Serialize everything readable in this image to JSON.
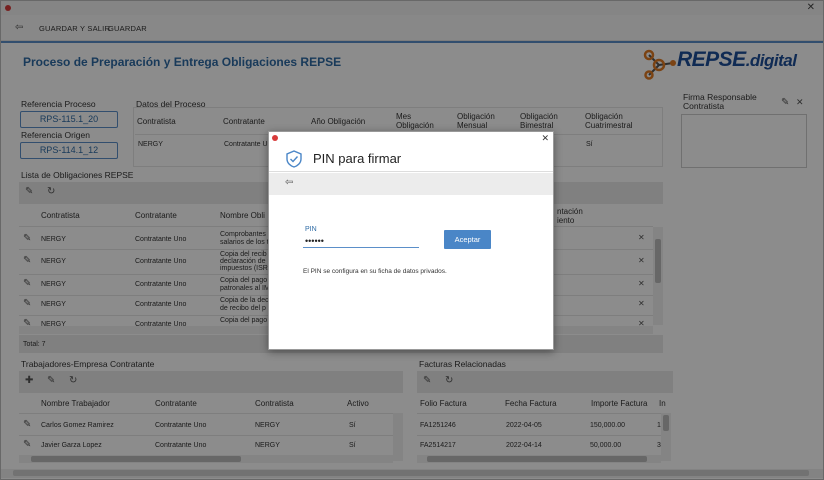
{
  "toolbar": {
    "save_exit_label": "GUARDAR Y SALIR",
    "save_label": "GUARDAR"
  },
  "header": {
    "title": "Proceso de Preparación y Entrega Obligaciones REPSE",
    "logo_text_main": "REPSE",
    "logo_text_suffix": ".digital"
  },
  "references": {
    "process_label": "Referencia Proceso",
    "process_value": "RPS-115.1_20",
    "origin_label": "Referencia Origen",
    "origin_value": "RPS-114.1_12"
  },
  "process_data": {
    "title": "Datos del Proceso",
    "headers": [
      "Contratista",
      "Contratante",
      "Año Obligación",
      "Mes Obligación",
      "Obligación Mensual",
      "Obligación Bimestral",
      "Obligación Cuatrimestral"
    ],
    "row": {
      "contratista": "NERGY",
      "contratante": "Contratante Un",
      "cuatrimestral": "Sí"
    }
  },
  "obligations": {
    "title": "Lista de Obligaciones REPSE",
    "headers": [
      "Contratista",
      "Contratante",
      "Nombre Obli",
      "ntación",
      "iento"
    ],
    "rows": [
      {
        "contratista": "NERGY",
        "contratante": "Contratante Uno",
        "nombre1": "Comprobantes",
        "nombre2": "salarios de los t"
      },
      {
        "contratista": "NERGY",
        "contratante": "Contratante Uno",
        "nombre1": "Copia del recib",
        "nombre2": "declaración de",
        "nombre3": "impuestos (ISR"
      },
      {
        "contratista": "NERGY",
        "contratante": "Contratante Uno",
        "nombre1": "Copia del pago",
        "nombre2": "patronales al IM"
      },
      {
        "contratista": "NERGY",
        "contratante": "Contratante Uno",
        "nombre1": "Copia de la dec",
        "nombre2": "de recibo del p"
      },
      {
        "contratista": "NERGY",
        "contratante": "Contratante Uno",
        "nombre1": "Copia del pago"
      }
    ],
    "total": "Total: 7"
  },
  "workers": {
    "title": "Trabajadores-Empresa Contratante",
    "headers": [
      "Nombre Trabajador",
      "Contratante",
      "Contratista",
      "Activo"
    ],
    "rows": [
      {
        "nombre": "Carlos Gomez Ramirez",
        "contratante": "Contratante Uno",
        "contratista": "NERGY",
        "activo": "Sí"
      },
      {
        "nombre": "Javier Garza Lopez",
        "contratante": "Contratante Uno",
        "contratista": "NERGY",
        "activo": "Sí"
      }
    ]
  },
  "invoices": {
    "title": "Facturas Relacionadas",
    "headers": [
      "Folio Factura",
      "Fecha Factura",
      "Importe Factura",
      "In"
    ],
    "rows": [
      {
        "folio": "FA1251246",
        "fecha": "2022-04-05",
        "importe": "150,000.00",
        "extra": "1"
      },
      {
        "folio": "FA2514217",
        "fecha": "2022-04-14",
        "importe": "50,000.00",
        "extra": "3"
      }
    ]
  },
  "signature": {
    "title": "Firma Responsable Contratista"
  },
  "modal": {
    "title": "PIN para firmar",
    "pin_label": "PIN",
    "pin_value": "••••••",
    "accept_label": "Aceptar",
    "note": "El PIN se configura en su ficha de datos privados."
  },
  "icons": {
    "back": "back-arrow-icon",
    "edit": "pencil-icon",
    "refresh": "refresh-icon",
    "add": "add-icon",
    "delete": "close-icon",
    "shield": "shield-check-icon"
  },
  "colors": {
    "accent": "#2e6ba5",
    "button": "#4a86c7",
    "close_dot": "#d83b3b"
  }
}
